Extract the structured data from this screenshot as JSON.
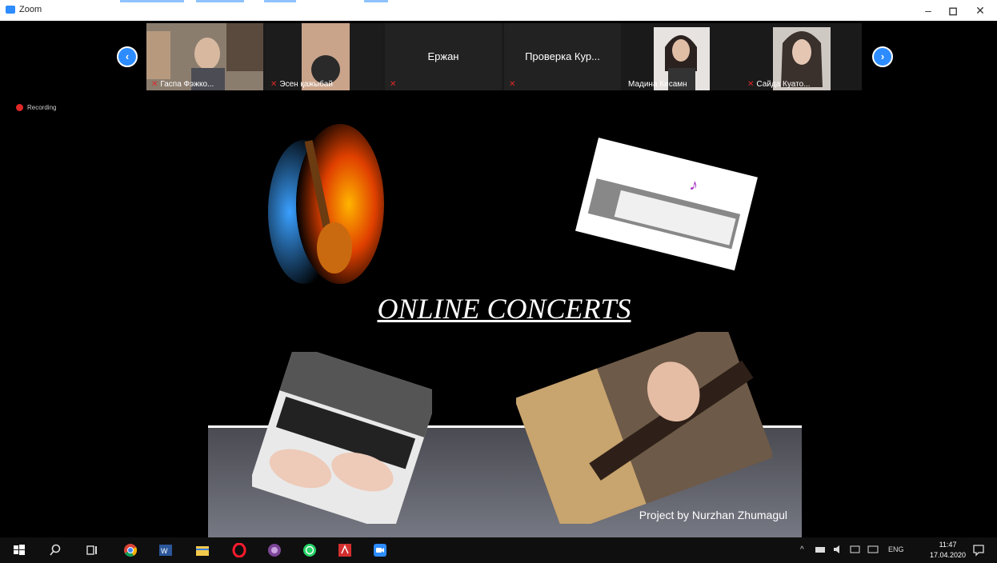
{
  "window": {
    "title": "Zoom",
    "controls": {
      "minimize": "–",
      "maximize": "◻",
      "close": "✕"
    }
  },
  "gallery": {
    "prev_arrow": "‹",
    "next_arrow": "›",
    "participants": [
      {
        "name": "Гаспа Фэжко...",
        "muted": true,
        "video": true
      },
      {
        "name": "Эсен қажыбай",
        "muted": true,
        "video": true
      },
      {
        "name": "Ержан",
        "muted": true,
        "video": false
      },
      {
        "name": "Проверка Кур...",
        "muted": true,
        "video": false
      },
      {
        "name": "Мадина Кисамн",
        "muted": false,
        "video": true
      },
      {
        "name": "Сайда Куатo...",
        "muted": true,
        "video": true
      }
    ]
  },
  "recording": {
    "label": "Recording"
  },
  "slide": {
    "title": "ONLINE CONCERTS",
    "credit": "Project by Nurzhan Zhumagul"
  },
  "taskbar": {
    "apps": [
      "windows-start",
      "search",
      "task-view",
      "chrome",
      "word",
      "file-explorer",
      "opera",
      "tor-browser",
      "whatsapp",
      "acrobat",
      "zoom"
    ],
    "tray": {
      "chevron": "^",
      "lang": "ENG"
    },
    "clock": {
      "time": "11:47",
      "date": "17.04.2020"
    }
  },
  "colors": {
    "zoom_blue": "#2d8cff",
    "mute_red": "#e02828"
  }
}
